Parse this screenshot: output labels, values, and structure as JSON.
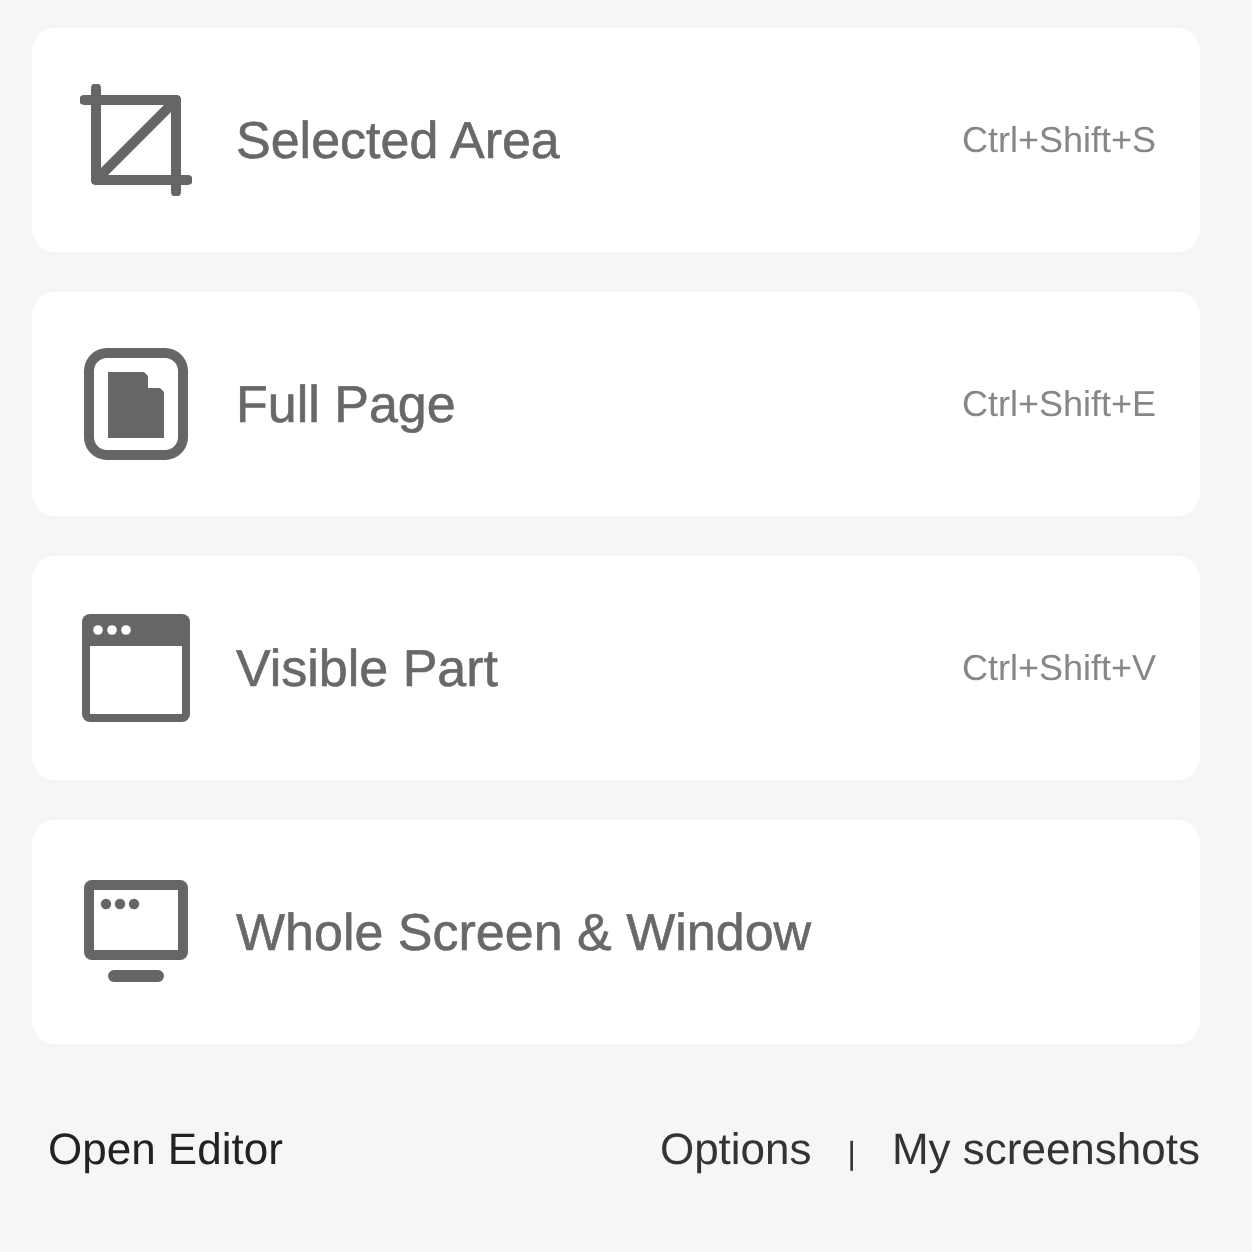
{
  "capture_options": [
    {
      "kind": "crop",
      "label": "Selected Area",
      "shortcut": "Ctrl+Shift+S"
    },
    {
      "kind": "page",
      "label": "Full Page",
      "shortcut": "Ctrl+Shift+E"
    },
    {
      "kind": "window",
      "label": "Visible Part",
      "shortcut": "Ctrl+Shift+V"
    },
    {
      "kind": "monitor",
      "label": "Whole Screen & Window"
    }
  ],
  "footer": {
    "left_link": "Open Editor",
    "right_links": [
      "Options",
      "My screenshots"
    ],
    "separator": "|"
  }
}
